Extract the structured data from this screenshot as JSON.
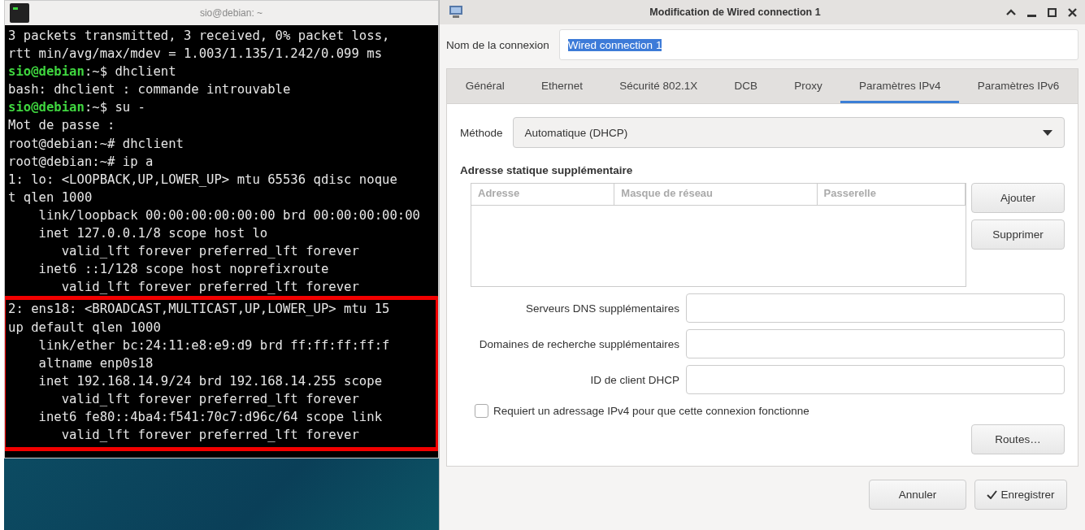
{
  "terminal": {
    "title": "sio@debian: ~",
    "lines": [
      {
        "text": "3 packets transmitted, 3 received, 0% packet loss,"
      },
      {
        "text": "rtt min/avg/max/mdev = 1.003/1.135/1.242/0.099 ms"
      },
      {
        "prompt": "sio@debian",
        "text": ":~$ dhclient"
      },
      {
        "text": "bash: dhclient : commande introuvable"
      },
      {
        "prompt": "sio@debian",
        "text": ":~$ su -"
      },
      {
        "text": "Mot de passe :"
      },
      {
        "text": "root@debian:~# dhclient"
      },
      {
        "text": "root@debian:~# ip a"
      },
      {
        "text": "1: lo: <LOOPBACK,UP,LOWER_UP> mtu 65536 qdisc noque"
      },
      {
        "text": "t qlen 1000"
      },
      {
        "text": "    link/loopback 00:00:00:00:00:00 brd 00:00:00:00:00"
      },
      {
        "text": "    inet 127.0.0.1/8 scope host lo"
      },
      {
        "text": "       valid_lft forever preferred_lft forever"
      },
      {
        "text": "    inet6 ::1/128 scope host noprefixroute"
      },
      {
        "text": "       valid_lft forever preferred_lft forever"
      }
    ],
    "highlighted_lines": [
      {
        "text": "2: ens18: <BROADCAST,MULTICAST,UP,LOWER_UP> mtu 15"
      },
      {
        "text": "up default qlen 1000"
      },
      {
        "text": "    link/ether bc:24:11:e8:e9:d9 brd ff:ff:ff:ff:f"
      },
      {
        "text": "    altname enp0s18"
      },
      {
        "text": "    inet 192.168.14.9/24 brd 192.168.14.255 scope"
      },
      {
        "text": "       valid_lft forever preferred_lft forever"
      },
      {
        "text": "    inet6 fe80::4ba4:f541:70c7:d96c/64 scope link"
      },
      {
        "text": "       valid_lft forever preferred_lft forever"
      }
    ]
  },
  "dialog": {
    "title": "Modification de Wired connection 1",
    "name_label": "Nom de la connexion",
    "name_value": "Wired connection 1",
    "tabs": [
      {
        "label": "Général",
        "selected": false
      },
      {
        "label": "Ethernet",
        "selected": false
      },
      {
        "label": "Sécurité 802.1X",
        "selected": false
      },
      {
        "label": "DCB",
        "selected": false
      },
      {
        "label": "Proxy",
        "selected": false
      },
      {
        "label": "Paramètres IPv4",
        "selected": true
      },
      {
        "label": "Paramètres IPv6",
        "selected": false
      }
    ],
    "method_label": "Méthode",
    "method_value": "Automatique (DHCP)",
    "section_title": "Adresse statique supplémentaire",
    "table_columns": [
      "Adresse",
      "Masque de réseau",
      "Passerelle"
    ],
    "table_buttons": [
      "Ajouter",
      "Supprimer"
    ],
    "fields": [
      {
        "label": "Serveurs DNS supplémentaires"
      },
      {
        "label": "Domaines de recherche supplémentaires"
      },
      {
        "label": "ID de client DHCP"
      }
    ],
    "require_ipv4": {
      "label": "Requiert un adressage IPv4 pour que cette connexion fonctionne",
      "checked": false
    },
    "routes_button": "Routes…",
    "cancel_button": "Annuler",
    "save_button": "Enregistrer"
  }
}
